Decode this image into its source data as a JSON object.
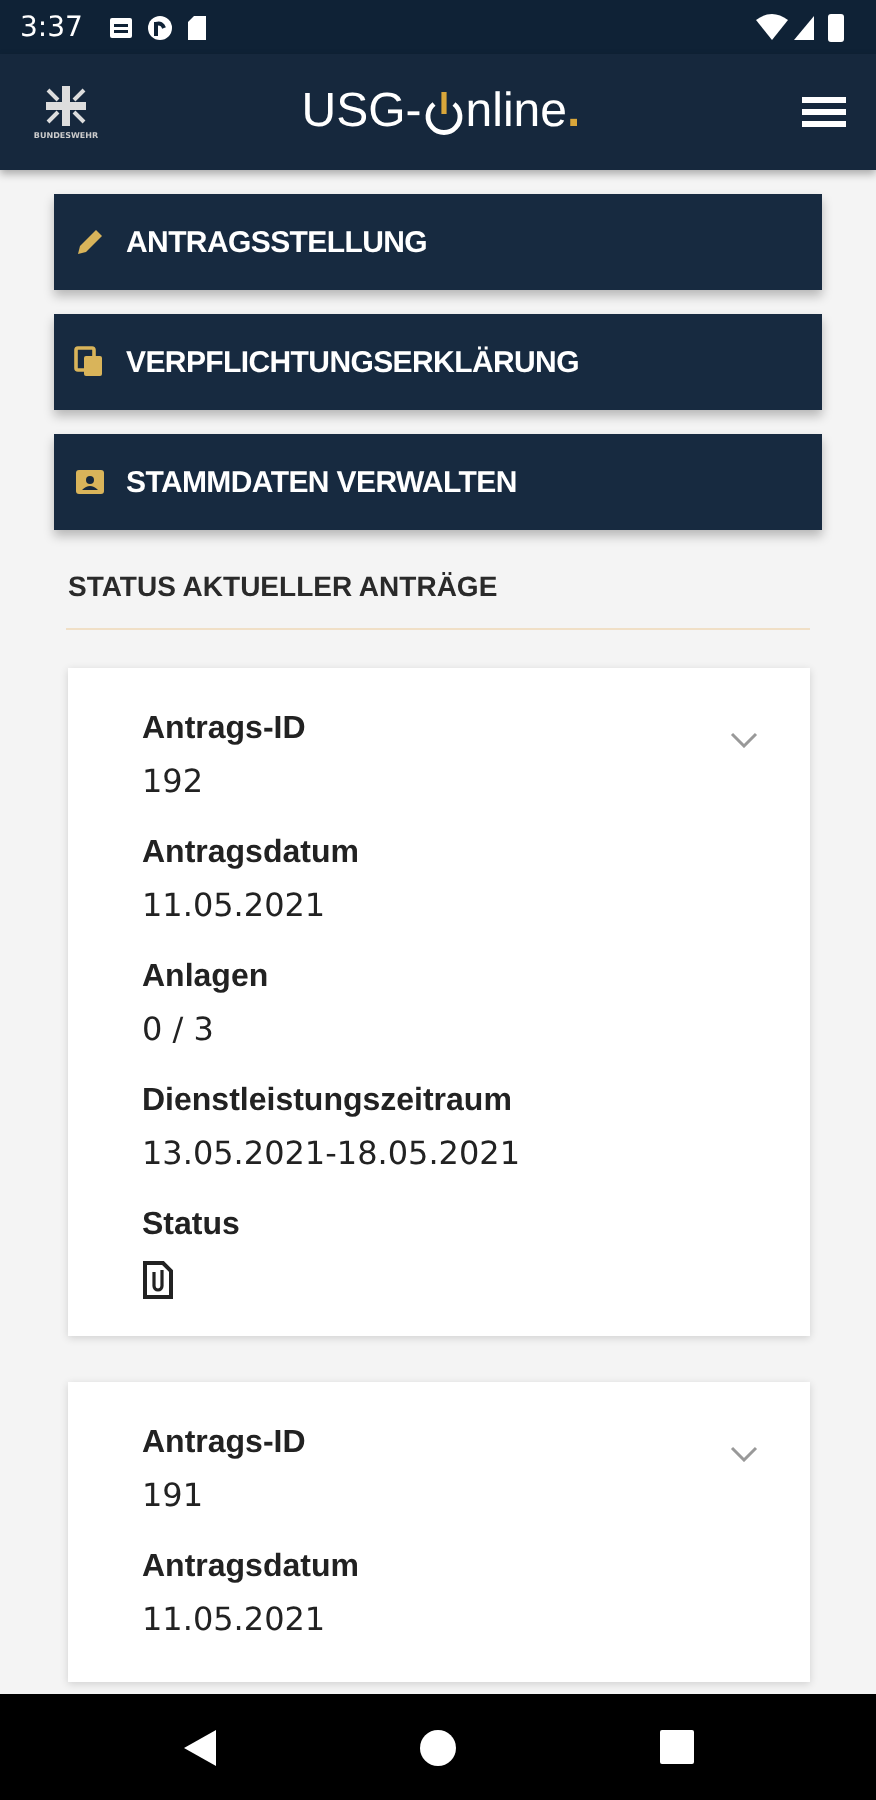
{
  "status_bar": {
    "time": "3:37"
  },
  "header": {
    "logo_caption": "BUNDESWEHR",
    "title_start": "USG-",
    "title_end": "nline",
    "title_dot": "."
  },
  "menu": [
    {
      "label": "ANTRAGSSTELLUNG",
      "kind": "pencil"
    },
    {
      "label": "VERPFLICHTUNGSERKLÄRUNG",
      "kind": "copy"
    },
    {
      "label": "STAMMDATEN VERWALTEN",
      "kind": "contact"
    }
  ],
  "section_title": "STATUS AKTUELLER ANTRÄGE",
  "requests": [
    {
      "expanded": false,
      "fields": [
        {
          "label": "Antrags-ID",
          "kind": "text",
          "value": "192"
        },
        {
          "label": "Antragsdatum",
          "kind": "text",
          "value": "11.05.2021"
        },
        {
          "label": "Anlagen",
          "kind": "text",
          "value": "0 / 3"
        },
        {
          "label": "Dienstleistungszeitraum",
          "kind": "text",
          "value": "13.05.2021-18.05.2021"
        },
        {
          "label": "Status",
          "kind": "attachment"
        }
      ]
    },
    {
      "expanded": false,
      "fields": [
        {
          "label": "Antrags-ID",
          "kind": "text",
          "value": "191"
        },
        {
          "label": "Antragsdatum",
          "kind": "text",
          "value": "11.05.2021"
        }
      ]
    }
  ]
}
